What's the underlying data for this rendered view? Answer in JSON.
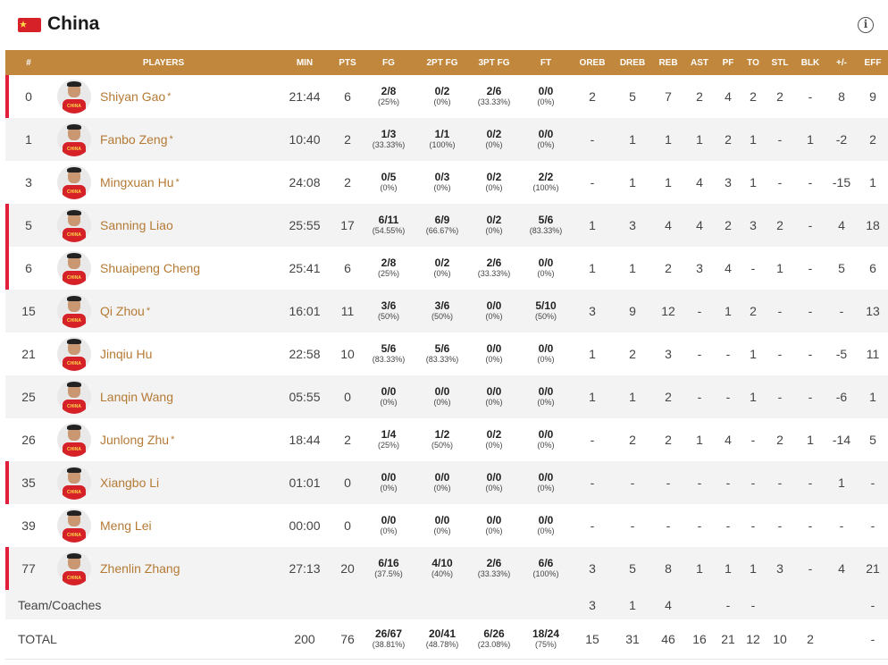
{
  "team": {
    "name": "China",
    "flag_color": "#d62128",
    "flag_star_color": "#ffd84a",
    "accent_color": "#c0873d",
    "starter_marker_color": "#e0203a",
    "info_icon": "info-circle-icon",
    "info_glyph": "i"
  },
  "columns": [
    "#",
    "PLAYERS",
    "MIN",
    "PTS",
    "FG",
    "2PT FG",
    "3PT FG",
    "FT",
    "OREB",
    "DREB",
    "REB",
    "AST",
    "PF",
    "TO",
    "STL",
    "BLK",
    "+/-",
    "EFF"
  ],
  "players": [
    {
      "num": "0",
      "name": "Shiyan Gao",
      "star": "*",
      "marked": true,
      "min": "21:44",
      "pts": "6",
      "fg": "2/8",
      "fg_pct": "(25%)",
      "p2": "0/2",
      "p2_pct": "(0%)",
      "p3": "2/6",
      "p3_pct": "(33.33%)",
      "ft": "0/0",
      "ft_pct": "(0%)",
      "oreb": "2",
      "dreb": "5",
      "reb": "7",
      "ast": "2",
      "pf": "4",
      "to": "2",
      "stl": "2",
      "blk": "-",
      "pm": "8",
      "eff": "9"
    },
    {
      "num": "1",
      "name": "Fanbo Zeng",
      "star": "*",
      "marked": false,
      "min": "10:40",
      "pts": "2",
      "fg": "1/3",
      "fg_pct": "(33.33%)",
      "p2": "1/1",
      "p2_pct": "(100%)",
      "p3": "0/2",
      "p3_pct": "(0%)",
      "ft": "0/0",
      "ft_pct": "(0%)",
      "oreb": "-",
      "dreb": "1",
      "reb": "1",
      "ast": "1",
      "pf": "2",
      "to": "1",
      "stl": "-",
      "blk": "1",
      "pm": "-2",
      "eff": "2"
    },
    {
      "num": "3",
      "name": "Mingxuan Hu",
      "star": "*",
      "marked": false,
      "min": "24:08",
      "pts": "2",
      "fg": "0/5",
      "fg_pct": "(0%)",
      "p2": "0/3",
      "p2_pct": "(0%)",
      "p3": "0/2",
      "p3_pct": "(0%)",
      "ft": "2/2",
      "ft_pct": "(100%)",
      "oreb": "-",
      "dreb": "1",
      "reb": "1",
      "ast": "4",
      "pf": "3",
      "to": "1",
      "stl": "-",
      "blk": "-",
      "pm": "-15",
      "eff": "1"
    },
    {
      "num": "5",
      "name": "Sanning Liao",
      "star": "",
      "marked": true,
      "min": "25:55",
      "pts": "17",
      "fg": "6/11",
      "fg_pct": "(54.55%)",
      "p2": "6/9",
      "p2_pct": "(66.67%)",
      "p3": "0/2",
      "p3_pct": "(0%)",
      "ft": "5/6",
      "ft_pct": "(83.33%)",
      "oreb": "1",
      "dreb": "3",
      "reb": "4",
      "ast": "4",
      "pf": "2",
      "to": "3",
      "stl": "2",
      "blk": "-",
      "pm": "4",
      "eff": "18"
    },
    {
      "num": "6",
      "name": "Shuaipeng Cheng",
      "star": "",
      "marked": true,
      "min": "25:41",
      "pts": "6",
      "fg": "2/8",
      "fg_pct": "(25%)",
      "p2": "0/2",
      "p2_pct": "(0%)",
      "p3": "2/6",
      "p3_pct": "(33.33%)",
      "ft": "0/0",
      "ft_pct": "(0%)",
      "oreb": "1",
      "dreb": "1",
      "reb": "2",
      "ast": "3",
      "pf": "4",
      "to": "-",
      "stl": "1",
      "blk": "-",
      "pm": "5",
      "eff": "6"
    },
    {
      "num": "15",
      "name": "Qi Zhou",
      "star": "*",
      "marked": false,
      "min": "16:01",
      "pts": "11",
      "fg": "3/6",
      "fg_pct": "(50%)",
      "p2": "3/6",
      "p2_pct": "(50%)",
      "p3": "0/0",
      "p3_pct": "(0%)",
      "ft": "5/10",
      "ft_pct": "(50%)",
      "oreb": "3",
      "dreb": "9",
      "reb": "12",
      "ast": "-",
      "pf": "1",
      "to": "2",
      "stl": "-",
      "blk": "-",
      "pm": "-",
      "eff": "13"
    },
    {
      "num": "21",
      "name": "Jinqiu Hu",
      "star": "",
      "marked": false,
      "min": "22:58",
      "pts": "10",
      "fg": "5/6",
      "fg_pct": "(83.33%)",
      "p2": "5/6",
      "p2_pct": "(83.33%)",
      "p3": "0/0",
      "p3_pct": "(0%)",
      "ft": "0/0",
      "ft_pct": "(0%)",
      "oreb": "1",
      "dreb": "2",
      "reb": "3",
      "ast": "-",
      "pf": "-",
      "to": "1",
      "stl": "-",
      "blk": "-",
      "pm": "-5",
      "eff": "11"
    },
    {
      "num": "25",
      "name": "Lanqin Wang",
      "star": "",
      "marked": false,
      "min": "05:55",
      "pts": "0",
      "fg": "0/0",
      "fg_pct": "(0%)",
      "p2": "0/0",
      "p2_pct": "(0%)",
      "p3": "0/0",
      "p3_pct": "(0%)",
      "ft": "0/0",
      "ft_pct": "(0%)",
      "oreb": "1",
      "dreb": "1",
      "reb": "2",
      "ast": "-",
      "pf": "-",
      "to": "1",
      "stl": "-",
      "blk": "-",
      "pm": "-6",
      "eff": "1"
    },
    {
      "num": "26",
      "name": "Junlong Zhu",
      "star": "*",
      "marked": false,
      "min": "18:44",
      "pts": "2",
      "fg": "1/4",
      "fg_pct": "(25%)",
      "p2": "1/2",
      "p2_pct": "(50%)",
      "p3": "0/2",
      "p3_pct": "(0%)",
      "ft": "0/0",
      "ft_pct": "(0%)",
      "oreb": "-",
      "dreb": "2",
      "reb": "2",
      "ast": "1",
      "pf": "4",
      "to": "-",
      "stl": "2",
      "blk": "1",
      "pm": "-14",
      "eff": "5"
    },
    {
      "num": "35",
      "name": "Xiangbo Li",
      "star": "",
      "marked": true,
      "min": "01:01",
      "pts": "0",
      "fg": "0/0",
      "fg_pct": "(0%)",
      "p2": "0/0",
      "p2_pct": "(0%)",
      "p3": "0/0",
      "p3_pct": "(0%)",
      "ft": "0/0",
      "ft_pct": "(0%)",
      "oreb": "-",
      "dreb": "-",
      "reb": "-",
      "ast": "-",
      "pf": "-",
      "to": "-",
      "stl": "-",
      "blk": "-",
      "pm": "1",
      "eff": "-"
    },
    {
      "num": "39",
      "name": "Meng Lei",
      "star": "",
      "marked": false,
      "min": "00:00",
      "pts": "0",
      "fg": "0/0",
      "fg_pct": "(0%)",
      "p2": "0/0",
      "p2_pct": "(0%)",
      "p3": "0/0",
      "p3_pct": "(0%)",
      "ft": "0/0",
      "ft_pct": "(0%)",
      "oreb": "-",
      "dreb": "-",
      "reb": "-",
      "ast": "-",
      "pf": "-",
      "to": "-",
      "stl": "-",
      "blk": "-",
      "pm": "-",
      "eff": "-"
    },
    {
      "num": "77",
      "name": "Zhenlin Zhang",
      "star": "",
      "marked": true,
      "min": "27:13",
      "pts": "20",
      "fg": "6/16",
      "fg_pct": "(37.5%)",
      "p2": "4/10",
      "p2_pct": "(40%)",
      "p3": "2/6",
      "p3_pct": "(33.33%)",
      "ft": "6/6",
      "ft_pct": "(100%)",
      "oreb": "3",
      "dreb": "5",
      "reb": "8",
      "ast": "1",
      "pf": "1",
      "to": "1",
      "stl": "3",
      "blk": "-",
      "pm": "4",
      "eff": "21"
    }
  ],
  "team_row": {
    "label": "Team/Coaches",
    "min": "",
    "pts": "",
    "fg": "",
    "fg_pct": "",
    "p2": "",
    "p2_pct": "",
    "p3": "",
    "p3_pct": "",
    "ft": "",
    "ft_pct": "",
    "oreb": "3",
    "dreb": "1",
    "reb": "4",
    "ast": "",
    "pf": "-",
    "to": "-",
    "stl": "",
    "blk": "",
    "pm": "",
    "eff": "-"
  },
  "total_row": {
    "label": "TOTAL",
    "min": "200",
    "pts": "76",
    "fg": "26/67",
    "fg_pct": "(38.81%)",
    "p2": "20/41",
    "p2_pct": "(48.78%)",
    "p3": "6/26",
    "p3_pct": "(23.08%)",
    "ft": "18/24",
    "ft_pct": "(75%)",
    "oreb": "15",
    "dreb": "31",
    "reb": "46",
    "ast": "16",
    "pf": "21",
    "to": "12",
    "stl": "10",
    "blk": "2",
    "pm": "",
    "eff": "-"
  }
}
